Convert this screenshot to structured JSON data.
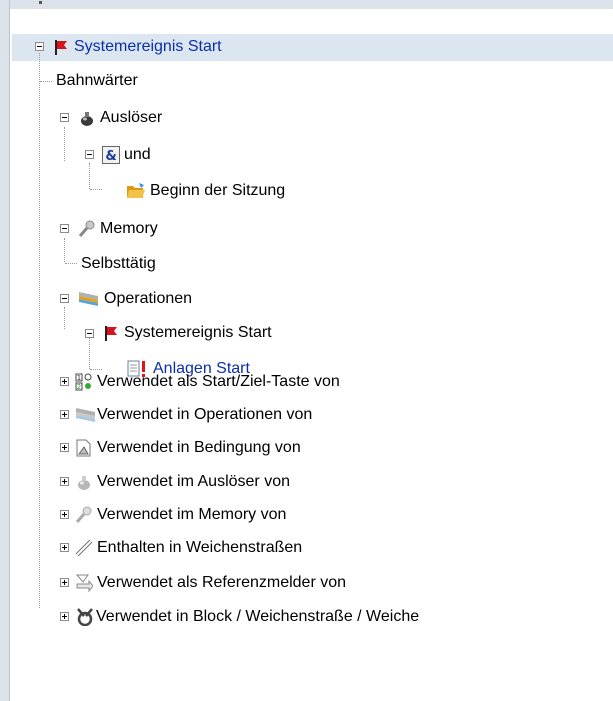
{
  "tree": {
    "root": {
      "label": "Systemereignis Start",
      "icon": "red-flag-icon"
    },
    "bahnwaerter": {
      "label": "Bahnwärter"
    },
    "ausloeser": {
      "label": "Auslöser",
      "icon": "trigger-icon"
    },
    "und": {
      "label": "und",
      "icon": "ampersand-icon"
    },
    "beginn": {
      "label": "Beginn der Sitzung",
      "icon": "folder-icon"
    },
    "memory": {
      "label": "Memory",
      "icon": "memory-icon"
    },
    "selbsttaetig": {
      "label": "Selbsttätig"
    },
    "operationen": {
      "label": "Operationen",
      "icon": "operations-icon"
    },
    "op_systemereignis": {
      "label": "Systemereignis Start",
      "icon": "red-flag-icon"
    },
    "anlagen_start": {
      "label": "Anlagen Start",
      "icon": "document-alert-icon"
    },
    "used_as_key": {
      "label": "Verwendet als Start/Ziel-Taste von",
      "icon": "keys-icon"
    },
    "used_in_ops": {
      "label": "Verwendet in Operationen von",
      "icon": "operations-icon"
    },
    "used_in_cond": {
      "label": "Verwendet in Bedingung von",
      "icon": "condition-icon"
    },
    "used_in_trigger": {
      "label": "Verwendet im Auslöser von",
      "icon": "trigger-icon"
    },
    "used_in_memory": {
      "label": "Verwendet im Memory von",
      "icon": "memory-icon"
    },
    "contained_in_routes": {
      "label": "Enthalten in Weichenstraßen",
      "icon": "route-icon"
    },
    "used_as_ref": {
      "label": "Verwendet als Referenzmelder von",
      "icon": "reference-icon"
    },
    "used_in_block": {
      "label": "Verwendet in Block / Weichenstraße / Weiche",
      "icon": "block-icon"
    }
  },
  "colors": {
    "selection": "#dce6f1",
    "link_text": "#0b2fa8",
    "flag_red": "#d6141c"
  }
}
